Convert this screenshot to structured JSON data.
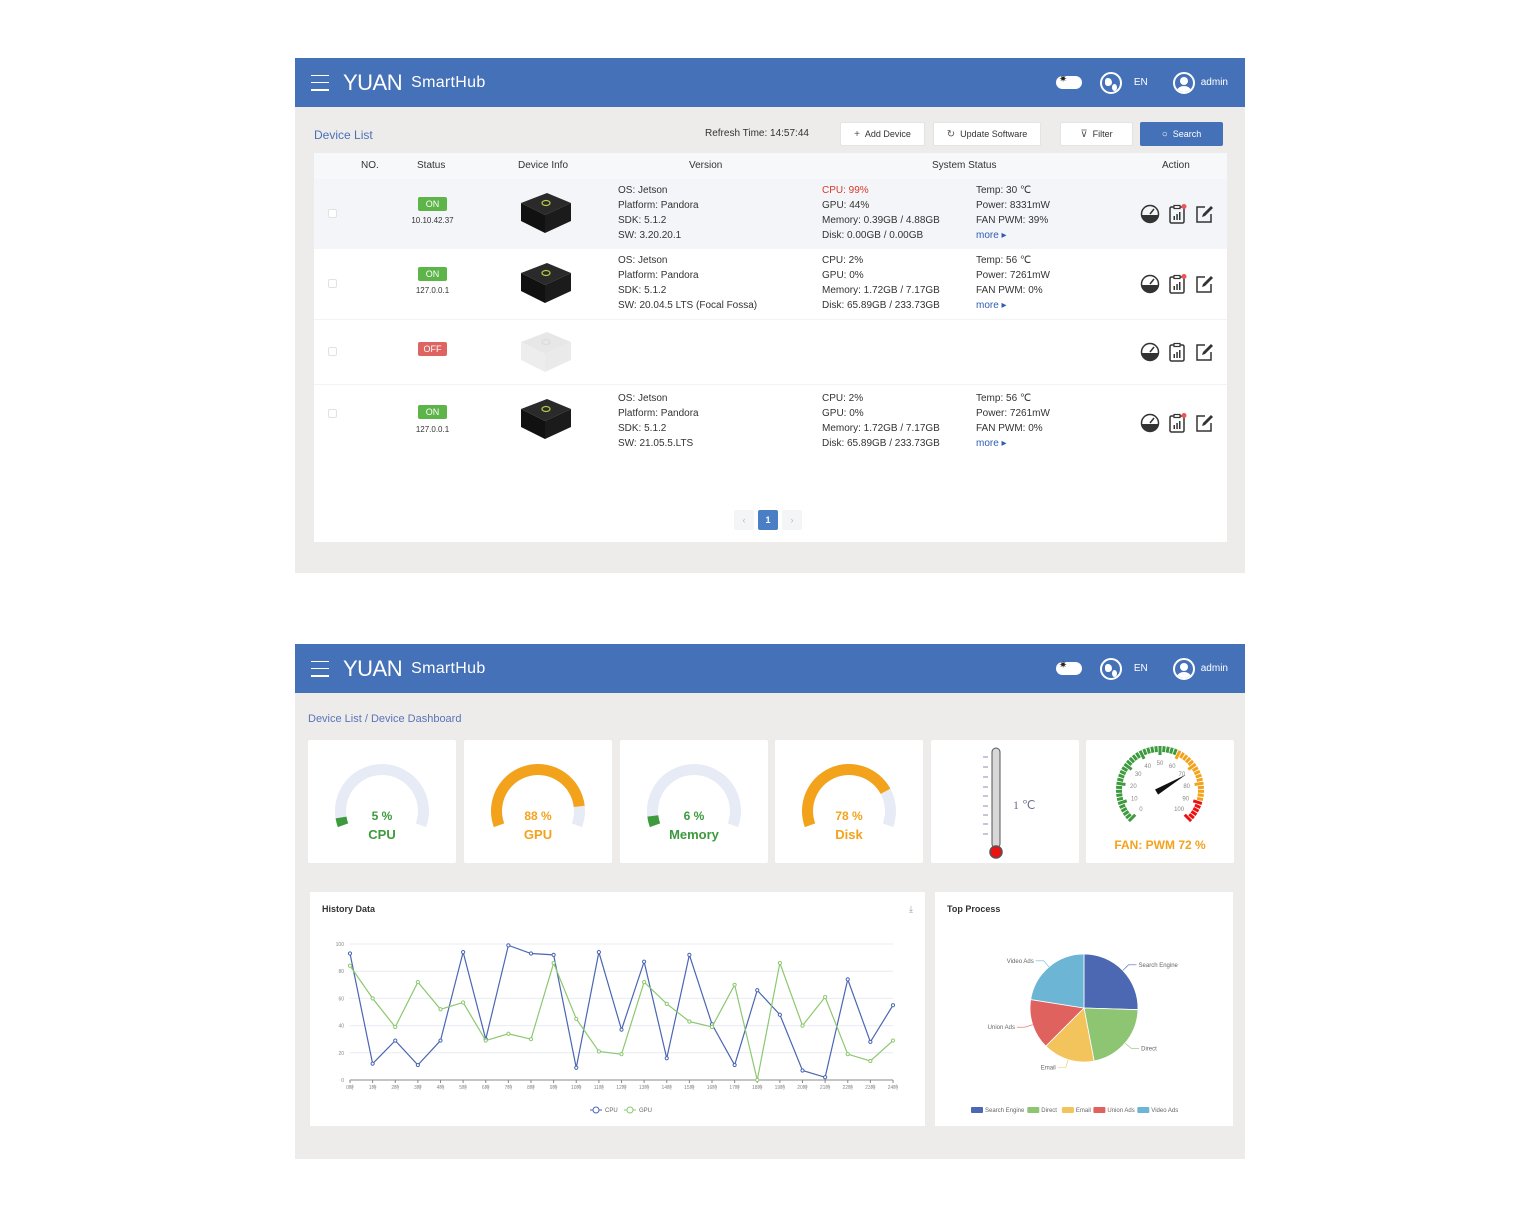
{
  "app": {
    "brand_main": "YUAN",
    "brand_sub": "SmartHub",
    "lang": "EN",
    "user": "admin"
  },
  "device_list": {
    "breadcrumb": "Device List",
    "refresh_label": "Refresh Time: 14:57:44",
    "buttons": {
      "add": "Add Device",
      "update": "Update Software",
      "filter": "Filter",
      "search": "Search"
    },
    "columns": [
      "NO.",
      "Status",
      "Device Info",
      "Version",
      "System Status",
      "Action"
    ],
    "rows": [
      {
        "status": "ON",
        "ip": "10.10.42.37",
        "os": "OS: Jetson",
        "platform": "Platform: Pandora",
        "sdk": "SDK: 5.1.2",
        "sw": "SW: 3.20.20.1",
        "cpu": "CPU: 99%",
        "gpu": "GPU: 44%",
        "memory": "Memory: 0.39GB / 4.88GB",
        "disk": "Disk: 0.00GB / 0.00GB",
        "temp": "Temp: 30 ℃",
        "power": "Power: 8331mW",
        "fan": "FAN PWM: 39%",
        "more": "more ▸",
        "cpu_alert": true,
        "has_notification": true
      },
      {
        "status": "ON",
        "ip": "127.0.0.1",
        "os": "OS: Jetson",
        "platform": "Platform: Pandora",
        "sdk": "SDK: 5.1.2",
        "sw": "SW: 20.04.5 LTS (Focal Fossa)",
        "cpu": "CPU: 2%",
        "gpu": "GPU: 0%",
        "memory": "Memory: 1.72GB / 7.17GB",
        "disk": "Disk: 65.89GB / 233.73GB",
        "temp": "Temp: 56 ℃",
        "power": "Power: 7261mW",
        "fan": "FAN PWM: 0%",
        "more": "more ▸",
        "cpu_alert": false,
        "has_notification": true
      },
      {
        "status": "OFF",
        "ip": "",
        "has_notification": false
      },
      {
        "status": "ON",
        "ip": "127.0.0.1",
        "os": "OS: Jetson",
        "platform": "Platform: Pandora",
        "sdk": "SDK: 5.1.2",
        "sw": "SW: 21.05.5.LTS",
        "cpu": "CPU: 2%",
        "gpu": "GPU: 0%",
        "memory": "Memory: 1.72GB / 7.17GB",
        "disk": "Disk: 65.89GB / 233.73GB",
        "temp": "Temp: 56 ℃",
        "power": "Power: 7261mW",
        "fan": "FAN PWM: 0%",
        "more": "more ▸",
        "cpu_alert": false,
        "has_notification": true
      }
    ],
    "pagination": {
      "prev": "‹",
      "current": "1",
      "next": "›"
    }
  },
  "dashboard": {
    "breadcrumb": "Device List / Device Dashboard",
    "gauges": [
      {
        "label": "CPU",
        "value": 5,
        "text": "5 %",
        "color": "#3d9a3d"
      },
      {
        "label": "GPU",
        "value": 88,
        "text": "88 %",
        "color": "#f3a21b"
      },
      {
        "label": "Memory",
        "value": 6,
        "text": "6 %",
        "color": "#3d9a3d"
      },
      {
        "label": "Disk",
        "value": 78,
        "text": "78 %",
        "color": "#f3a21b"
      }
    ],
    "temperature": {
      "text": "1 ℃",
      "value": 1
    },
    "fan": {
      "label": "FAN: PWM 72 %",
      "value": 72,
      "ticks": [
        "0",
        "10",
        "20",
        "30",
        "40",
        "50",
        "60",
        "70",
        "80",
        "90",
        "100"
      ]
    },
    "history_title": "History Data",
    "process_title": "Top Process"
  },
  "colors": {
    "header": "#4471b8",
    "cpu": "#4a66b3",
    "gpu": "#8cc870",
    "gauge_track": "#e6ebf5"
  },
  "chart_data": [
    {
      "type": "line",
      "title": "History Data",
      "x": [
        "0時",
        "1時",
        "2時",
        "3時",
        "4時",
        "5時",
        "6時",
        "7時",
        "8時",
        "9時",
        "10時",
        "11時",
        "12時",
        "13時",
        "14時",
        "15時",
        "16時",
        "17時",
        "18時",
        "19時",
        "20時",
        "21時",
        "22時",
        "23時",
        "24時"
      ],
      "ylim": [
        0,
        100
      ],
      "yticks": [
        0,
        20,
        40,
        60,
        80,
        100
      ],
      "grid": true,
      "legend": "bottom-center",
      "series": [
        {
          "name": "CPU",
          "color": "#4a66b3",
          "values": [
            93,
            12,
            29,
            11,
            29,
            94,
            30,
            99,
            93,
            92,
            9,
            94,
            37,
            87,
            16,
            92,
            41,
            11,
            66,
            48,
            7,
            2,
            74,
            28,
            55
          ]
        },
        {
          "name": "GPU",
          "color": "#8cc870",
          "values": [
            84,
            60,
            39,
            72,
            52,
            57,
            29,
            34,
            30,
            86,
            45,
            21,
            19,
            72,
            56,
            43,
            39,
            70,
            0,
            86,
            40,
            61,
            19,
            14,
            29
          ]
        }
      ]
    },
    {
      "type": "pie",
      "title": "Top Process",
      "legend": "bottom-center",
      "slices": [
        {
          "name": "Search Engine",
          "value": 25.5,
          "color": "#4c68b2"
        },
        {
          "name": "Direct",
          "value": 21.5,
          "color": "#8dc572"
        },
        {
          "name": "Email",
          "value": 15.5,
          "color": "#f3c35c"
        },
        {
          "name": "Union Ads",
          "value": 15,
          "color": "#e0625f"
        },
        {
          "name": "Video Ads",
          "value": 22.5,
          "color": "#6cb5d4"
        }
      ]
    }
  ]
}
